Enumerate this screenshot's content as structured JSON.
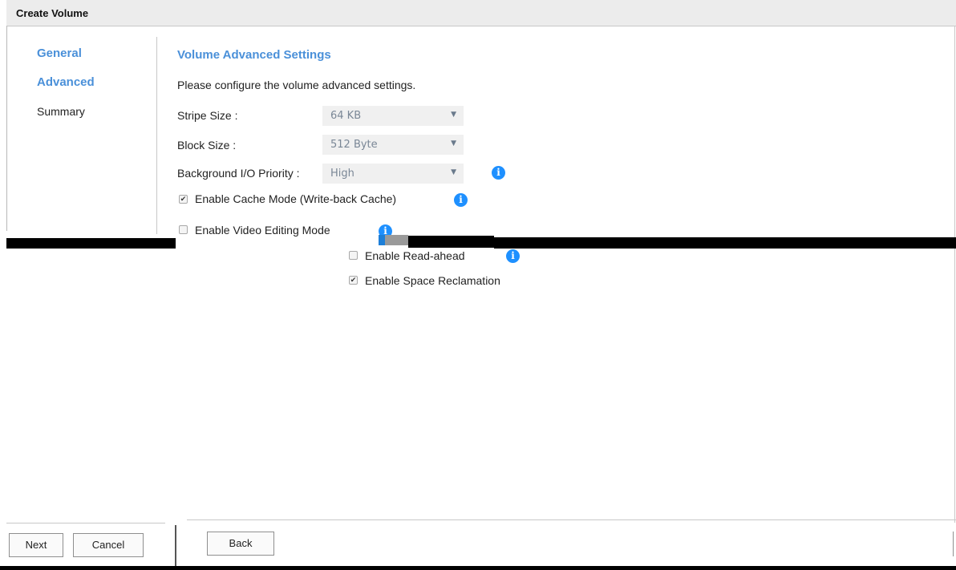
{
  "window": {
    "title": "Create Volume"
  },
  "nav": {
    "items": [
      {
        "label": "General",
        "state": "active"
      },
      {
        "label": "Advanced",
        "state": "active"
      },
      {
        "label": "Summary",
        "state": "normal"
      }
    ]
  },
  "main": {
    "section_title": "Volume Advanced Settings",
    "description": "Please configure the volume advanced settings.",
    "stripe_size": {
      "label": "Stripe Size :",
      "value": "64 KB"
    },
    "block_size": {
      "label": "Block Size :",
      "value": "512 Byte"
    },
    "bg_priority": {
      "label": "Background I/O Priority :",
      "value": "High"
    },
    "cache_mode": {
      "label": "Enable Cache Mode (Write-back Cache)",
      "checked": true
    },
    "video_editing": {
      "label": "Enable Video Editing Mode",
      "checked": false
    },
    "read_ahead": {
      "label": "Enable Read-ahead",
      "checked": false
    },
    "space_reclamation": {
      "label": "Enable Space Reclamation",
      "checked": true
    }
  },
  "footer": {
    "next_label": "Next",
    "cancel_label": "Cancel",
    "back_label": "Back"
  },
  "icons": {
    "info": "info-icon",
    "dropdown": "chevron-down-icon",
    "check": "check-icon"
  },
  "colors": {
    "accent": "#4a90d9",
    "info": "#1e90ff"
  }
}
